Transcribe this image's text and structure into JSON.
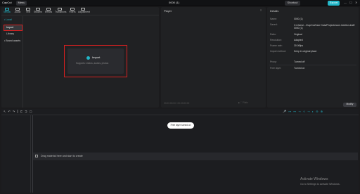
{
  "app": {
    "logo": "CapCut",
    "menu_label": "Menu",
    "project_title": "0000 (1)"
  },
  "header": {
    "shortcut_label": "Shortcut",
    "export_label": "Export",
    "minimize": "—",
    "maximize": "☐",
    "close": "✕"
  },
  "toolbar": {
    "media": "Media",
    "audio": "Audio",
    "text": "Text",
    "stickers": "Stickers",
    "effects": "Effects",
    "transitions": "Transitions",
    "filters": "Filters",
    "adjustment": "Adjustment"
  },
  "left_nav": {
    "local": "• Local",
    "import": "Import",
    "library": "Library",
    "brand": "• Brand assets"
  },
  "import_area": {
    "label": "Import",
    "sub": "Supports: videos, audios, photos"
  },
  "player": {
    "title": "Player",
    "menu": "≡",
    "timecode": "00:00:00:00 / 00:00:00:00",
    "controls": "▶   ⛶   Ratio"
  },
  "details": {
    "title": "Details",
    "rows": [
      {
        "label": "Name:",
        "value": "0000 (1)"
      },
      {
        "label": "Saved:",
        "value": "C:/Users/.../CapCut/User Data/Projects/com.lveditor.draft/0000 (1)"
      },
      {
        "label": "Ratio:",
        "value": "Original"
      },
      {
        "label": "Resolution:",
        "value": "Adapted"
      },
      {
        "label": "Frame rate:",
        "value": "30.00fps"
      },
      {
        "label": "Import method:",
        "value": "Keep in original place"
      },
      {
        "label": "Proxy:",
        "value": "Turned off"
      },
      {
        "label": "Free layer:",
        "value": "Turned on"
      }
    ],
    "modify_label": "Modify"
  },
  "timeline": {
    "left_tools": "↖ ↶ ↷  ⫿  ⊏  ⊐  ▢",
    "right_tools": "🎤 ⊶ ⊷ ⊸ ⊹ ⊸ ◐ ⊖ ⊕",
    "tooltip": "Free layer turned on",
    "drop_text": "Drag material here and start to create"
  },
  "system": {
    "activate_title": "Activate Windows",
    "activate_sub": "Go to Settings to activate Windows."
  },
  "colors": {
    "accent": "#22b6c8",
    "highlight": "#d62020",
    "panel": "#202123",
    "bg": "#1b1b1d"
  }
}
